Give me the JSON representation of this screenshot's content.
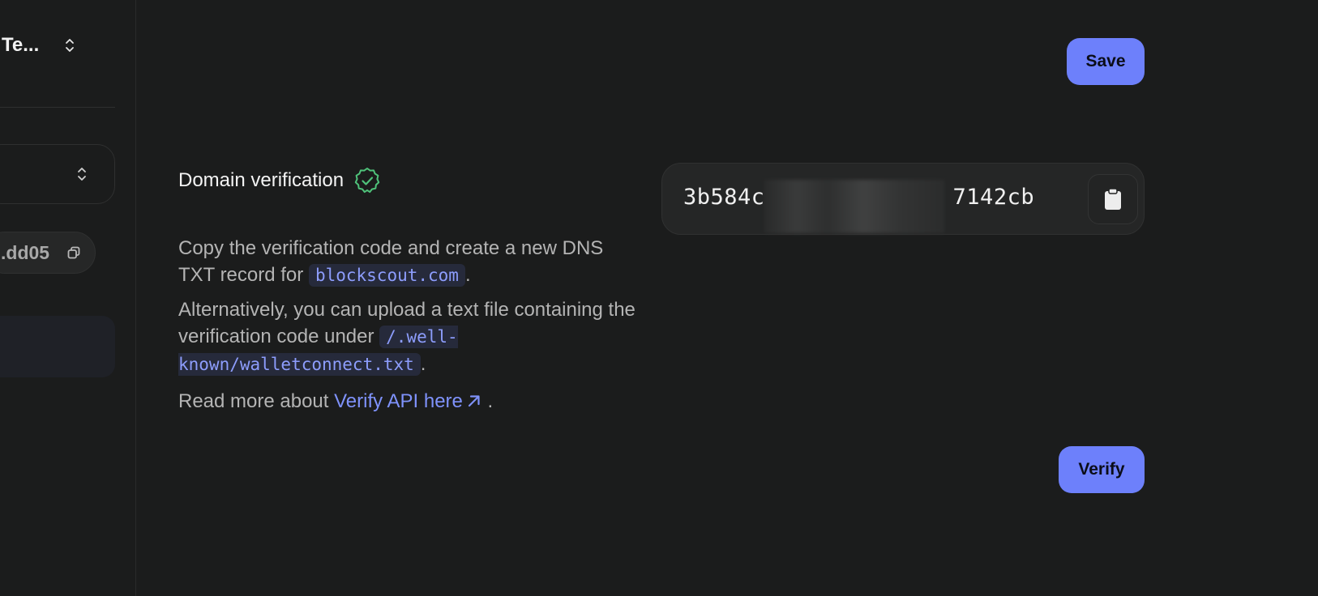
{
  "sidebar": {
    "project_name": "Te...",
    "address_short": ".dd05"
  },
  "toolbar": {
    "save_label": "Save"
  },
  "domain_verification": {
    "title": "Domain verification",
    "desc1_before": "Copy the verification code and create a new DNS TXT record for ",
    "desc1_code": "blockscout.com",
    "desc1_after": ".",
    "desc2_before": "Alternatively, you can upload a text file containing the verification code under ",
    "desc2_code": "/.well-known/walletconnect.txt",
    "desc2_after": ".",
    "desc3_before": "Read more about ",
    "desc3_link": "Verify API here",
    "desc3_after": " .",
    "token_prefix": "3b584c",
    "token_suffix": "7142cb",
    "verify_label": "Verify"
  },
  "colors": {
    "accent": "#6d80fb",
    "background": "#1b1c1c",
    "verified_badge": "#4fc27a",
    "code_text": "#8d9dfc"
  },
  "icons": {
    "project_switcher": "chevron-updown-icon",
    "select": "chevron-updown-icon",
    "address_copy": "copy-icon",
    "verified": "verified-badge-icon",
    "external_link": "arrow-up-right-icon",
    "token_copy": "clipboard-icon"
  }
}
